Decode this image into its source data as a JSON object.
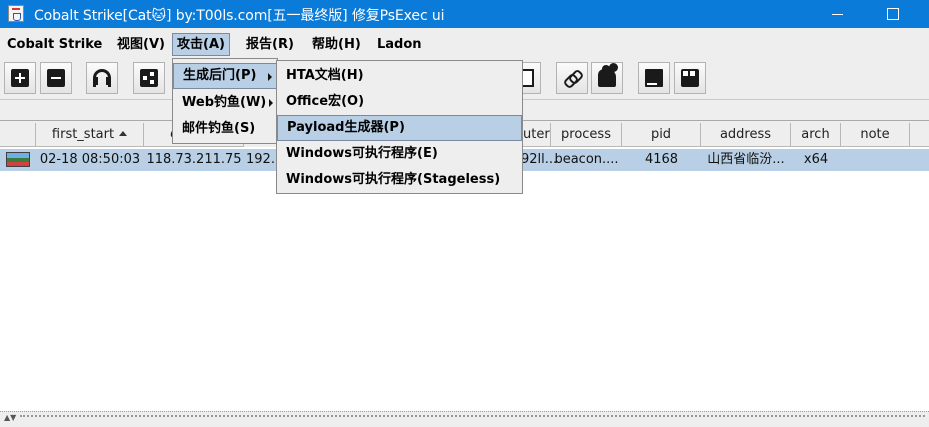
{
  "window": {
    "title": "Cobalt Strike[Cat🐱] by:T00ls.com[五一最终版] 修复PsExec ui"
  },
  "menubar": {
    "items": [
      {
        "label": "Cobalt Strike"
      },
      {
        "label": "视图(V)"
      },
      {
        "label": "攻击(A)"
      },
      {
        "label": "报告(R)"
      },
      {
        "label": "帮助(H)"
      },
      {
        "label": "Ladon"
      }
    ]
  },
  "toolbar": {
    "buttons": [
      {
        "icon": "plus-icon"
      },
      {
        "icon": "minus-icon"
      },
      {
        "icon": "headphones-icon"
      },
      {
        "icon": "pivot-graph-icon"
      },
      {
        "icon": "page-icon"
      },
      {
        "icon": "link-icon"
      },
      {
        "icon": "cloud-icon"
      },
      {
        "icon": "book-icon"
      },
      {
        "icon": "cube-icon"
      }
    ]
  },
  "attack_menu": {
    "items": [
      {
        "label": "生成后门(P)",
        "has_submenu": true
      },
      {
        "label": "Web钓鱼(W)",
        "has_submenu": true
      },
      {
        "label": "邮件钓鱼(S)",
        "has_submenu": false
      }
    ]
  },
  "backdoor_submenu": {
    "items": [
      {
        "label": "HTA文档(H)"
      },
      {
        "label": "Office宏(O)"
      },
      {
        "label": "Payload生成器(P)"
      },
      {
        "label": "Windows可执行程序(E)"
      },
      {
        "label": "Windows可执行程序(Stageless)"
      }
    ]
  },
  "table": {
    "columns": {
      "first_start": "first_start",
      "external": "e",
      "computer": "uter",
      "process": "process",
      "pid": "pid",
      "address": "address",
      "arch": "arch",
      "note": "note"
    },
    "sorted_column": "first_start",
    "rows": [
      {
        "first_start": "02-18 08:50:03",
        "external": "118.73.211.75",
        "internal": "192.1",
        "computer": "92ll...",
        "process": "beacon....",
        "pid": "4168",
        "address": "山西省临汾...",
        "arch": "x64",
        "note": ""
      }
    ]
  },
  "colors": {
    "titlebar": "#0a7bd8",
    "selection": "#b8cfe5"
  }
}
